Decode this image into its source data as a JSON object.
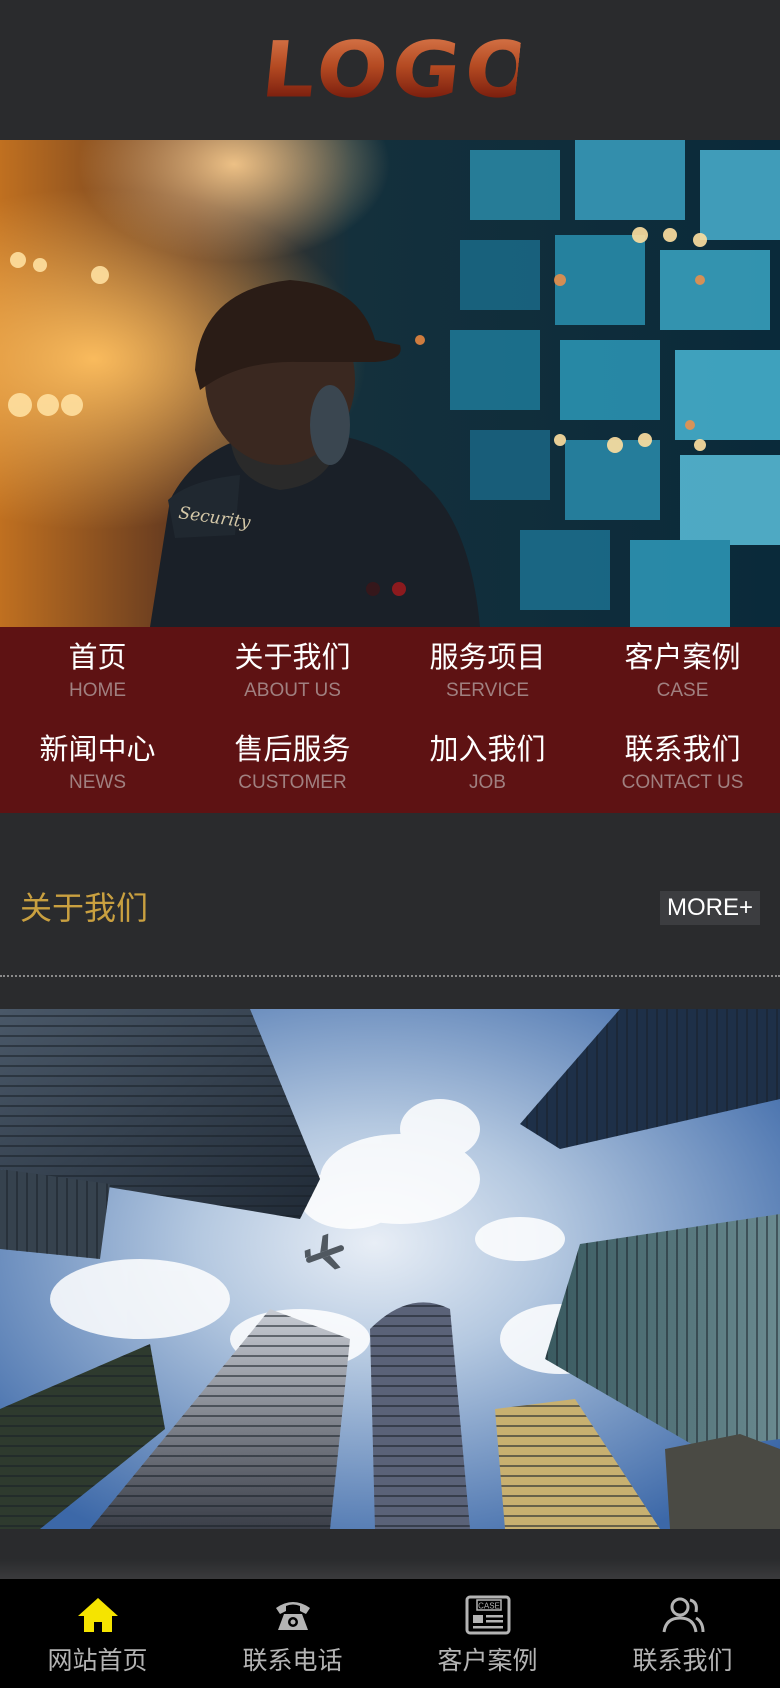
{
  "header": {
    "logo_text": "LOGO"
  },
  "banner": {
    "patch_text": "Security",
    "slide_count": 2,
    "active_slide": 2
  },
  "nav": {
    "items": [
      {
        "cn": "首页",
        "en": "HOME"
      },
      {
        "cn": "关于我们",
        "en": "ABOUT US"
      },
      {
        "cn": "服务项目",
        "en": "SERVICE"
      },
      {
        "cn": "客户案例",
        "en": "CASE"
      },
      {
        "cn": "新闻中心",
        "en": "NEWS"
      },
      {
        "cn": "售后服务",
        "en": "CUSTOMER"
      },
      {
        "cn": "加入我们",
        "en": "JOB"
      },
      {
        "cn": "联系我们",
        "en": "CONTACT US"
      }
    ]
  },
  "about": {
    "title": "关于我们",
    "more_label": "MORE+"
  },
  "tabbar": {
    "items": [
      {
        "label": "网站首页",
        "icon": "home-icon",
        "active": true
      },
      {
        "label": "联系电话",
        "icon": "phone-icon",
        "active": false
      },
      {
        "label": "客户案例",
        "icon": "case-icon",
        "active": false
      },
      {
        "label": "联系我们",
        "icon": "contacts-icon",
        "active": false
      }
    ]
  },
  "colors": {
    "background": "#2a2b2d",
    "nav_background": "#5e1213",
    "section_title": "#c9a040",
    "tab_active_icon": "#f5e400",
    "tab_inactive": "#b4b4b4"
  }
}
